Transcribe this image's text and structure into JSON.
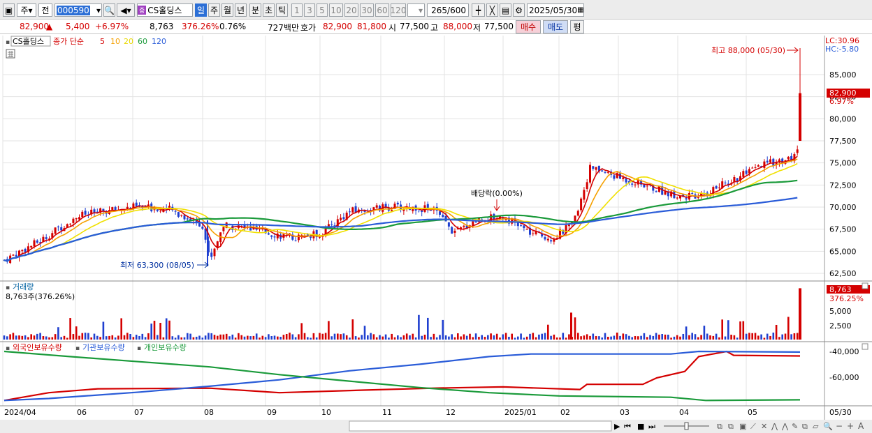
{
  "toolbar": {
    "period": "주",
    "nav": "전",
    "code": "000590",
    "stock_name": "CS홀딩스",
    "tabs": [
      "일",
      "주",
      "월",
      "년",
      "분",
      "초",
      "틱"
    ],
    "minutes": [
      "1",
      "3",
      "5",
      "10",
      "20",
      "30",
      "60",
      "120"
    ],
    "count": "265",
    "count_total": "/600",
    "date": "2025/05/30"
  },
  "info": {
    "price": "82,900",
    "arrow": "▲",
    "change": "5,400",
    "change_pct": "+6.97%",
    "volume": "8,763",
    "volume_pct": "376.26%",
    "turnover": "0.76%",
    "amount": "727백만",
    "ask_label": "호가",
    "ask": "82,900",
    "bid": "81,800",
    "open_label": "시",
    "open": "77,500",
    "high_label": "고",
    "high": "88,000",
    "low_label": "저",
    "low": "77,500",
    "buy": "매수",
    "sell": "매도",
    "extra": "평"
  },
  "price_panel": {
    "legend_name": "CS홀딩스",
    "legend_ma_title": "종가 단순",
    "ma": [
      "5",
      "10",
      "20",
      "60",
      "120"
    ],
    "ma_colors": [
      "#d40000",
      "#f5a000",
      "#f0e000",
      "#1a9a3a",
      "#2a5cd8"
    ],
    "lc": "LC:30.96",
    "hc": "HC:-5.80",
    "current_price": "82,900",
    "current_pct": "6.97%",
    "high_note": "최고 88,000 (05/30)",
    "low_note": "최저 63,300 (08/05)",
    "dividend_note": "배당락(0.00%)",
    "y_ticks": [
      "85,000",
      "82,500",
      "80,000",
      "77,500",
      "75,000",
      "72,500",
      "70,000",
      "67,500",
      "65,000",
      "62,500"
    ]
  },
  "volume_panel": {
    "title": "거래량",
    "value": "8,763주(376.26%)",
    "badge": "8,763",
    "badge_pct": "376.25%",
    "y_ticks": [
      "5,000",
      "2,500"
    ]
  },
  "holdings_panel": {
    "series": [
      "외국인보유수량",
      "기관보유수량",
      "개인보유수량"
    ],
    "colors": [
      "#d40000",
      "#2a5cd8",
      "#1a9a3a"
    ],
    "y_ticks": [
      "-40,000",
      "-60,000"
    ]
  },
  "x_axis": {
    "labels": [
      "2024/04",
      "06",
      "07",
      "08",
      "09",
      "10",
      "11",
      "12",
      "2025/01",
      "02",
      "03",
      "04",
      "05"
    ],
    "right_label": "05/30"
  }
}
